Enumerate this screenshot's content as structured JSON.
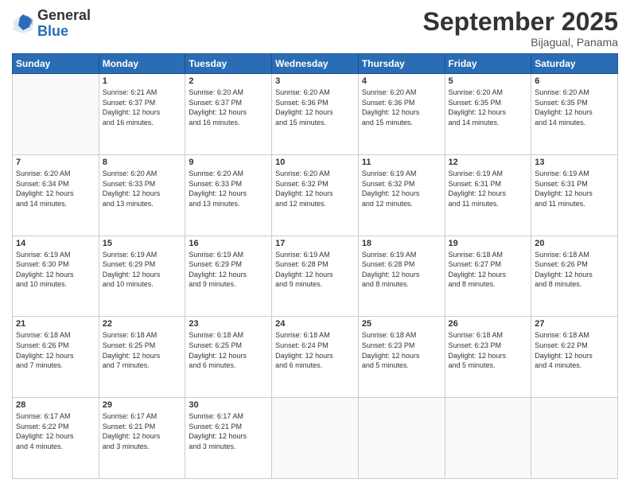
{
  "header": {
    "logo": {
      "general": "General",
      "blue": "Blue"
    },
    "title": "September 2025",
    "location": "Bijagual, Panama"
  },
  "weekdays": [
    "Sunday",
    "Monday",
    "Tuesday",
    "Wednesday",
    "Thursday",
    "Friday",
    "Saturday"
  ],
  "weeks": [
    [
      {
        "day": "",
        "info": ""
      },
      {
        "day": "1",
        "info": "Sunrise: 6:21 AM\nSunset: 6:37 PM\nDaylight: 12 hours\nand 16 minutes."
      },
      {
        "day": "2",
        "info": "Sunrise: 6:20 AM\nSunset: 6:37 PM\nDaylight: 12 hours\nand 16 minutes."
      },
      {
        "day": "3",
        "info": "Sunrise: 6:20 AM\nSunset: 6:36 PM\nDaylight: 12 hours\nand 15 minutes."
      },
      {
        "day": "4",
        "info": "Sunrise: 6:20 AM\nSunset: 6:36 PM\nDaylight: 12 hours\nand 15 minutes."
      },
      {
        "day": "5",
        "info": "Sunrise: 6:20 AM\nSunset: 6:35 PM\nDaylight: 12 hours\nand 14 minutes."
      },
      {
        "day": "6",
        "info": "Sunrise: 6:20 AM\nSunset: 6:35 PM\nDaylight: 12 hours\nand 14 minutes."
      }
    ],
    [
      {
        "day": "7",
        "info": "Sunrise: 6:20 AM\nSunset: 6:34 PM\nDaylight: 12 hours\nand 14 minutes."
      },
      {
        "day": "8",
        "info": "Sunrise: 6:20 AM\nSunset: 6:33 PM\nDaylight: 12 hours\nand 13 minutes."
      },
      {
        "day": "9",
        "info": "Sunrise: 6:20 AM\nSunset: 6:33 PM\nDaylight: 12 hours\nand 13 minutes."
      },
      {
        "day": "10",
        "info": "Sunrise: 6:20 AM\nSunset: 6:32 PM\nDaylight: 12 hours\nand 12 minutes."
      },
      {
        "day": "11",
        "info": "Sunrise: 6:19 AM\nSunset: 6:32 PM\nDaylight: 12 hours\nand 12 minutes."
      },
      {
        "day": "12",
        "info": "Sunrise: 6:19 AM\nSunset: 6:31 PM\nDaylight: 12 hours\nand 11 minutes."
      },
      {
        "day": "13",
        "info": "Sunrise: 6:19 AM\nSunset: 6:31 PM\nDaylight: 12 hours\nand 11 minutes."
      }
    ],
    [
      {
        "day": "14",
        "info": "Sunrise: 6:19 AM\nSunset: 6:30 PM\nDaylight: 12 hours\nand 10 minutes."
      },
      {
        "day": "15",
        "info": "Sunrise: 6:19 AM\nSunset: 6:29 PM\nDaylight: 12 hours\nand 10 minutes."
      },
      {
        "day": "16",
        "info": "Sunrise: 6:19 AM\nSunset: 6:29 PM\nDaylight: 12 hours\nand 9 minutes."
      },
      {
        "day": "17",
        "info": "Sunrise: 6:19 AM\nSunset: 6:28 PM\nDaylight: 12 hours\nand 9 minutes."
      },
      {
        "day": "18",
        "info": "Sunrise: 6:19 AM\nSunset: 6:28 PM\nDaylight: 12 hours\nand 8 minutes."
      },
      {
        "day": "19",
        "info": "Sunrise: 6:18 AM\nSunset: 6:27 PM\nDaylight: 12 hours\nand 8 minutes."
      },
      {
        "day": "20",
        "info": "Sunrise: 6:18 AM\nSunset: 6:26 PM\nDaylight: 12 hours\nand 8 minutes."
      }
    ],
    [
      {
        "day": "21",
        "info": "Sunrise: 6:18 AM\nSunset: 6:26 PM\nDaylight: 12 hours\nand 7 minutes."
      },
      {
        "day": "22",
        "info": "Sunrise: 6:18 AM\nSunset: 6:25 PM\nDaylight: 12 hours\nand 7 minutes."
      },
      {
        "day": "23",
        "info": "Sunrise: 6:18 AM\nSunset: 6:25 PM\nDaylight: 12 hours\nand 6 minutes."
      },
      {
        "day": "24",
        "info": "Sunrise: 6:18 AM\nSunset: 6:24 PM\nDaylight: 12 hours\nand 6 minutes."
      },
      {
        "day": "25",
        "info": "Sunrise: 6:18 AM\nSunset: 6:23 PM\nDaylight: 12 hours\nand 5 minutes."
      },
      {
        "day": "26",
        "info": "Sunrise: 6:18 AM\nSunset: 6:23 PM\nDaylight: 12 hours\nand 5 minutes."
      },
      {
        "day": "27",
        "info": "Sunrise: 6:18 AM\nSunset: 6:22 PM\nDaylight: 12 hours\nand 4 minutes."
      }
    ],
    [
      {
        "day": "28",
        "info": "Sunrise: 6:17 AM\nSunset: 6:22 PM\nDaylight: 12 hours\nand 4 minutes."
      },
      {
        "day": "29",
        "info": "Sunrise: 6:17 AM\nSunset: 6:21 PM\nDaylight: 12 hours\nand 3 minutes."
      },
      {
        "day": "30",
        "info": "Sunrise: 6:17 AM\nSunset: 6:21 PM\nDaylight: 12 hours\nand 3 minutes."
      },
      {
        "day": "",
        "info": ""
      },
      {
        "day": "",
        "info": ""
      },
      {
        "day": "",
        "info": ""
      },
      {
        "day": "",
        "info": ""
      }
    ]
  ]
}
